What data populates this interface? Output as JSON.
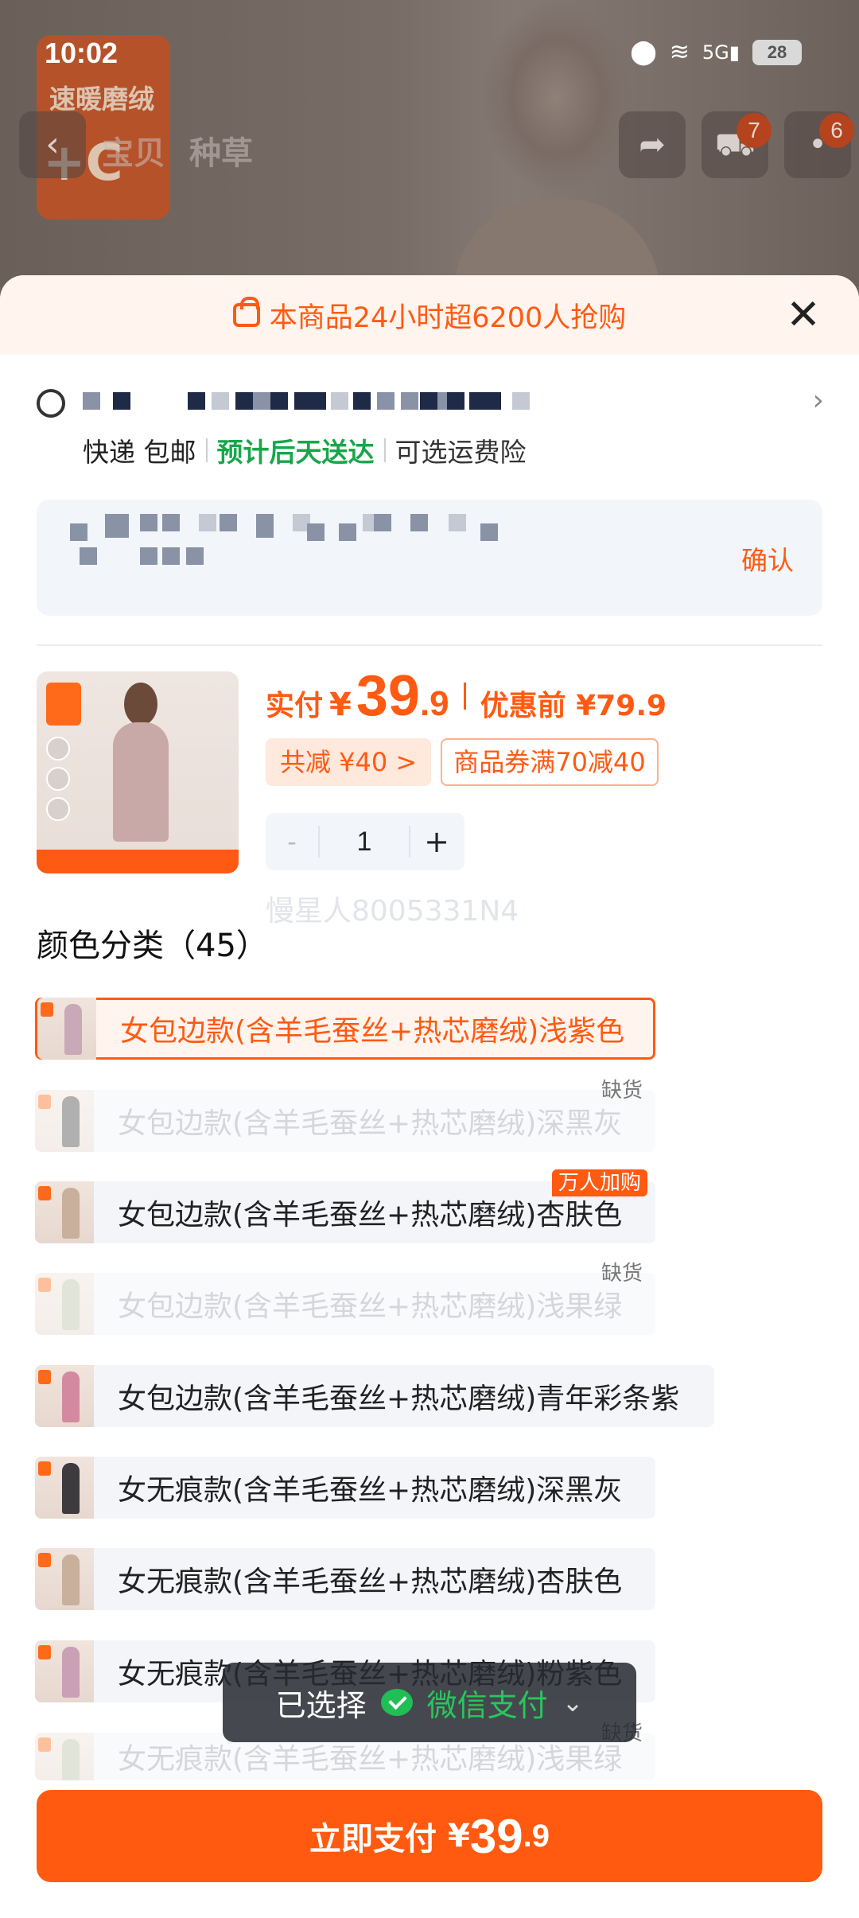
{
  "status_bar": {
    "time": "10:02",
    "network": "5G",
    "battery": "28"
  },
  "background": {
    "logo_text": "速暖磨绒",
    "logo_temp": "+C",
    "nav_tabs": [
      "宝贝",
      "种草"
    ],
    "cart_badge": "7",
    "more_badge": "6"
  },
  "sheet": {
    "banner": "本商品24小时超6200人抢购",
    "shipping": {
      "method": "快递 包邮",
      "eta": "预计后天送达",
      "insurance": "可选运费险"
    },
    "address_confirm": "确认",
    "price": {
      "label": "实付",
      "currency": "¥",
      "integer": "39",
      "decimal": ".9",
      "original": "优惠前 ¥79.9"
    },
    "coupons": {
      "discount": "共减 ¥40 >",
      "voucher": "商品券满70减40"
    },
    "quantity": {
      "minus": "-",
      "value": "1",
      "plus": "+"
    },
    "watermark": "慢星人8005331N4",
    "section_title": "颜色分类（45）",
    "variants": [
      {
        "label": "女包边款(含羊毛蚕丝+热芯磨绒)浅紫色",
        "state": "selected",
        "tag": ""
      },
      {
        "label": "女包边款(含羊毛蚕丝+热芯磨绒)深黑灰",
        "state": "disabled",
        "tag": "缺货"
      },
      {
        "label": "女包边款(含羊毛蚕丝+热芯磨绒)杏肤色",
        "state": "normal",
        "tag": "万人加购"
      },
      {
        "label": "女包边款(含羊毛蚕丝+热芯磨绒)浅果绿",
        "state": "disabled",
        "tag": "缺货"
      },
      {
        "label": "女包边款(含羊毛蚕丝+热芯磨绒)青年彩条紫",
        "state": "normal",
        "tag": ""
      },
      {
        "label": "女无痕款(含羊毛蚕丝+热芯磨绒)深黑灰",
        "state": "normal",
        "tag": ""
      },
      {
        "label": "女无痕款(含羊毛蚕丝+热芯磨绒)杏肤色",
        "state": "normal",
        "tag": ""
      },
      {
        "label": "女无痕款(含羊毛蚕丝+热芯磨绒)粉紫色",
        "state": "normal",
        "tag": ""
      },
      {
        "label": "女无痕款(含羊毛蚕丝+热芯磨绒)浅果绿",
        "state": "disabled",
        "tag": "缺货"
      }
    ],
    "payment_pill": {
      "label": "已选择",
      "method": "微信支付",
      "chevron": "⌄"
    },
    "pay_button": {
      "label": "立即支付",
      "currency": "¥",
      "integer": "39",
      "decimal": ".9"
    }
  },
  "colors": {
    "accent": "#ff5a12",
    "eta_green": "#18a64a",
    "wechat_green": "#27c75c"
  }
}
